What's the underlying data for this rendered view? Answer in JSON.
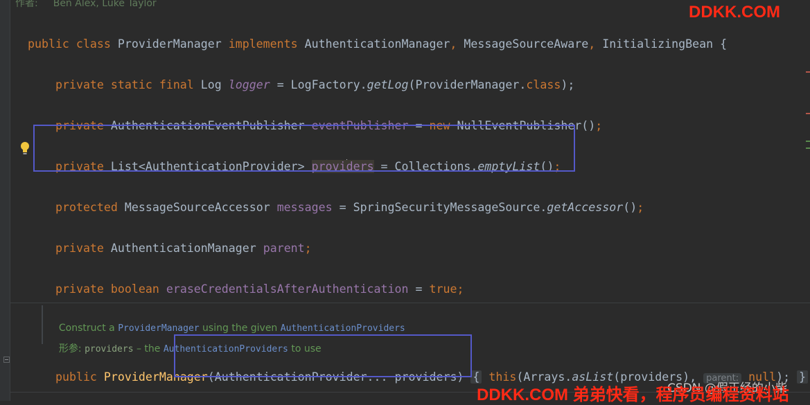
{
  "header": {
    "author_label": "作者:",
    "author_value": "Ben Alex, Luke Taylor"
  },
  "code": {
    "class_decl": {
      "kw1": "public class ",
      "name": "ProviderManager ",
      "kw2": "implements ",
      "iface1": "AuthenticationManager",
      "comma1": ", ",
      "iface2": "MessageSourceAware",
      "comma2": ", ",
      "iface3": "InitializingBean ",
      "brace": "{"
    },
    "logger_line": {
      "kw": "private static final ",
      "type": "Log ",
      "name": "logger",
      "eq": " = LogFactory.",
      "method": "getLog",
      "args": "(ProviderManager.",
      "cls_kw": "class",
      "end": ");"
    },
    "publisher_line": {
      "kw": "private ",
      "type": "AuthenticationEventPublisher ",
      "name": "eventPublisher",
      "eq": " = ",
      "new_kw": "new ",
      "rest": "NullEventPublisher()",
      "semi": ";"
    },
    "providers_line": {
      "kw": "private ",
      "type": "List<AuthenticationProvider> ",
      "name_a": "provi",
      "name_b": "ders",
      "eq": " = Collections.",
      "method": "emptyList",
      "end": "()",
      "semi": ";"
    },
    "messages_line": {
      "kw": "protected ",
      "type": "MessageSourceAccessor ",
      "name": "messages",
      "eq": " = SpringSecurityMessageSource.",
      "method": "getAccessor",
      "end": "()",
      "semi": ";"
    },
    "parent_line": {
      "kw": "private ",
      "type": "AuthenticationManager ",
      "name": "parent",
      "semi": ";"
    },
    "erase_line": {
      "kw": "private boolean ",
      "name": "eraseCredentialsAfterAuthentication",
      "eq": " = ",
      "val": "true",
      "semi": ";"
    },
    "doc": {
      "line1_a": "Construct a ",
      "line1_ref1": "ProviderManager",
      "line1_b": " using the given ",
      "line1_ref2": "AuthenticationProviders",
      "line2_a": "形参: ",
      "line2_code": "providers",
      "line2_b": " – the ",
      "line2_ref": "AuthenticationProviders",
      "line2_c": " to use"
    },
    "ctor_line": {
      "kw": "public ",
      "name": "ProviderManager",
      "params": "(AuthenticationProvider... providers) ",
      "brace_open": "{",
      "this_kw": " this",
      "call": "(Arrays.",
      "method": "asList",
      "args": "(providers), ",
      "hint": "parent:",
      "null_kw": " null",
      "end": "); ",
      "brace_close": "}"
    }
  },
  "watermarks": {
    "top": "DDKK.COM",
    "bottom": "DDKK.COM 弟弟快看，程序员编程资料站",
    "csdn": "CSDN @假正经的小柴"
  },
  "colors": {
    "background": "#2b2b2b",
    "keyword": "#cc7832",
    "field": "#9876aa",
    "method": "#ffc66d",
    "text": "#a9b7c6",
    "highlight_box": "#5459c9",
    "watermark": "#ff2a16"
  }
}
